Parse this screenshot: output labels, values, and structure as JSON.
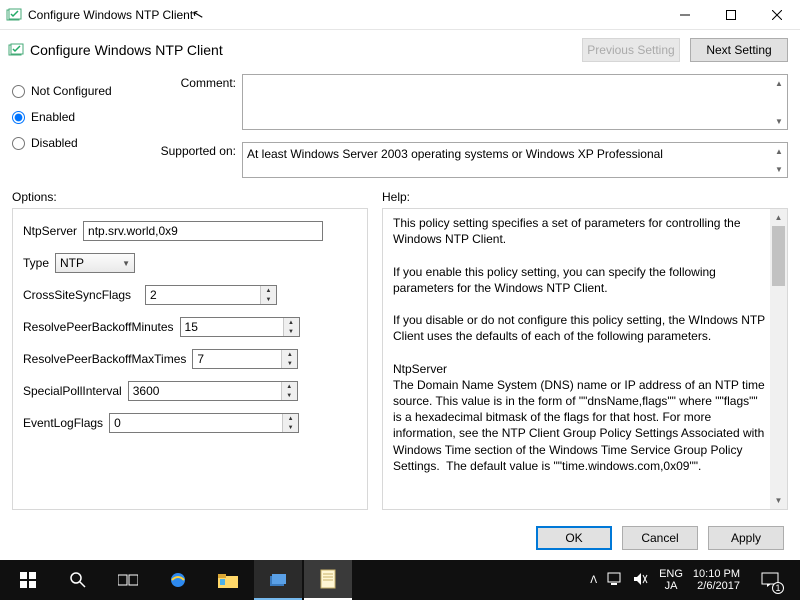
{
  "titlebar": {
    "title": "Configure Windows NTP Client"
  },
  "header": {
    "label": "Configure Windows NTP Client",
    "prev_btn": "Previous Setting",
    "next_btn": "Next Setting"
  },
  "state": {
    "not_configured": "Not Configured",
    "enabled": "Enabled",
    "disabled": "Disabled"
  },
  "meta": {
    "comment_label": "Comment:",
    "comment_value": "",
    "supported_label": "Supported on:",
    "supported_value": "At least Windows Server 2003 operating systems or Windows XP Professional"
  },
  "sections": {
    "options": "Options:",
    "help": "Help:"
  },
  "options": {
    "ntpserver_label": "NtpServer",
    "ntpserver_value": "ntp.srv.world,0x9",
    "type_label": "Type",
    "type_value": "NTP",
    "crosssite_label": "CrossSiteSyncFlags",
    "crosssite_value": "2",
    "resolvemin_label": "ResolvePeerBackoffMinutes",
    "resolvemin_value": "15",
    "resolvemax_label": "ResolvePeerBackoffMaxTimes",
    "resolvemax_value": "7",
    "specialpoll_label": "SpecialPollInterval",
    "specialpoll_value": "3600",
    "eventlog_label": "EventLogFlags",
    "eventlog_value": "0"
  },
  "help_text": "This policy setting specifies a set of parameters for controlling the Windows NTP Client.\n\nIf you enable this policy setting, you can specify the following parameters for the Windows NTP Client.\n\nIf you disable or do not configure this policy setting, the WIndows NTP Client uses the defaults of each of the following parameters.\n\nNtpServer\nThe Domain Name System (DNS) name or IP address of an NTP time source. This value is in the form of \"\"dnsName,flags\"\" where \"\"flags\"\" is a hexadecimal bitmask of the flags for that host. For more information, see the NTP Client Group Policy Settings Associated with Windows Time section of the Windows Time Service Group Policy Settings.  The default value is \"\"time.windows.com,0x09\"\".",
  "buttons": {
    "ok": "OK",
    "cancel": "Cancel",
    "apply": "Apply"
  },
  "tray": {
    "lang1": "ENG",
    "lang2": "JA",
    "time": "10:10 PM",
    "date": "2/6/2017",
    "notify_count": "1"
  }
}
